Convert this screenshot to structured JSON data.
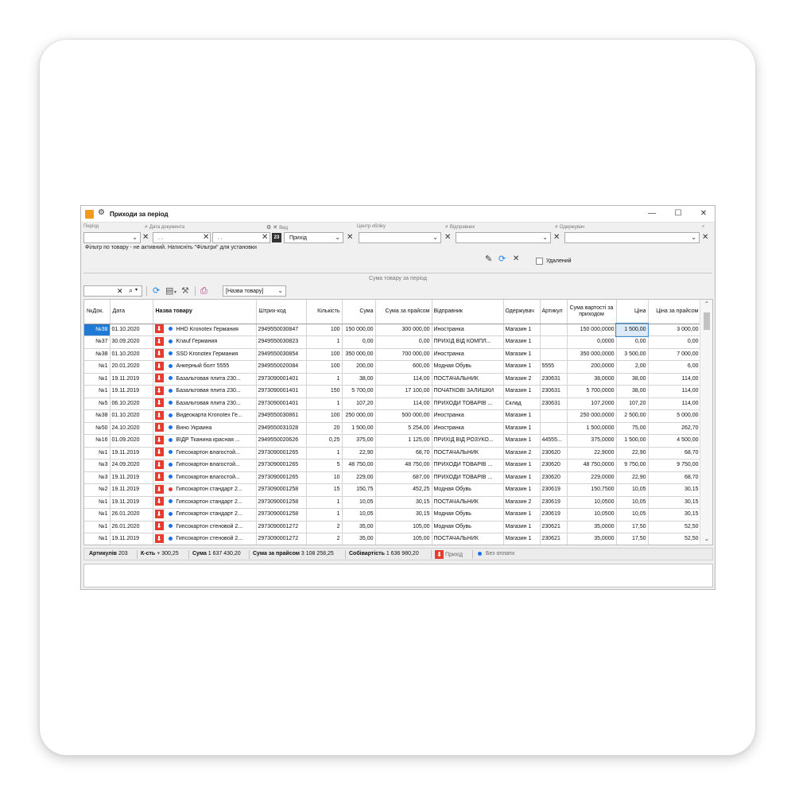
{
  "window": {
    "title": "Приходи за період",
    "controls": {
      "minimize": "—",
      "maximize": "☐",
      "close": "✕"
    }
  },
  "filters": {
    "labels": {
      "period": "Період",
      "doc_date": "Дата документа",
      "kind": "Вид",
      "center": "Центр обліку",
      "sender": "Відправник",
      "receiver": "Одержувач"
    },
    "date_from": ". .",
    "date_to": ". .",
    "calendar_day": "23",
    "kind_value": "Прихід",
    "hint": "Фільтр по товару - не активний. Натисніть \"Фільтри\" для установки",
    "deleted_label": "Удалений"
  },
  "sum_caption": "Сума товару за період",
  "toolbar": {
    "column_select": "[Назва товару]"
  },
  "columns": {
    "doc": "№Док.",
    "date": "Дата",
    "name": "Назва товару",
    "barcode": "Штрих-код",
    "qty": "Кількість",
    "sum": "Сума",
    "sum_price": "Сума за прайсом",
    "sender": "Відправник",
    "receiver": "Одержувач",
    "article": "Артикул",
    "cost": "Сума вартості за приходом",
    "price": "Ціна",
    "price_list": "Ціна за прайсом"
  },
  "rows": [
    {
      "doc": "№38",
      "date": "01.10.2020",
      "dot": "#1a73e8",
      "name": "HHD Kronotex Германия",
      "barcode": "2949550030847",
      "qty": "100",
      "sum": "150 000,00",
      "sum_price": "300 000,00",
      "sender": "Иностранка",
      "receiver": "Магазин 1",
      "article": "",
      "cost": "150 000,0000",
      "price": "1 500,00",
      "price_list": "3 000,00"
    },
    {
      "doc": "№37",
      "date": "30.09.2020",
      "dot": "#1a73e8",
      "name": "Knauf Германия",
      "barcode": "2949550030823",
      "qty": "1",
      "sum": "0,00",
      "sum_price": "0,00",
      "sender": "ПРИХІД ВІД КОМПЛ...",
      "receiver": "Магазин 1",
      "article": "",
      "cost": "0,0000",
      "price": "0,00",
      "price_list": "0,00"
    },
    {
      "doc": "№38",
      "date": "01.10.2020",
      "dot": "#1a73e8",
      "name": "SSD Kronotex Германия",
      "barcode": "2949550030854",
      "qty": "100",
      "sum": "350 000,00",
      "sum_price": "700 000,00",
      "sender": "Иностранка",
      "receiver": "Магазин 1",
      "article": "",
      "cost": "350 000,0000",
      "price": "3 500,00",
      "price_list": "7 000,00"
    },
    {
      "doc": "№1",
      "date": "20.01.2020",
      "dot": "#1a73e8",
      "name": "Анкерный болт 5555",
      "barcode": "2949550020084",
      "qty": "100",
      "sum": "200,00",
      "sum_price": "600,00",
      "sender": "Модная Обувь",
      "receiver": "Магазин 1",
      "article": "5555",
      "cost": "200,0000",
      "price": "2,00",
      "price_list": "6,00"
    },
    {
      "doc": "№1",
      "date": "19.11.2019",
      "dot": "#1a73e8",
      "name": "Базальтовая плита 230...",
      "barcode": "2973090001401",
      "qty": "1",
      "sum": "38,00",
      "sum_price": "114,00",
      "sender": "ПОСТАЧАЛЬНИК",
      "receiver": "Магазин 2",
      "article": "230631",
      "cost": "38,0000",
      "price": "38,00",
      "price_list": "114,00"
    },
    {
      "doc": "№1",
      "date": "19.11.2019",
      "dot": "#1a73e8",
      "name": "Базальтовая плита 230...",
      "barcode": "2973090001401",
      "qty": "150",
      "sum": "5 700,00",
      "sum_price": "17 100,00",
      "sender": "ПОЧАТКОВІ ЗАЛИШКИ",
      "receiver": "Магазин 1",
      "article": "230631",
      "cost": "5 700,0000",
      "price": "38,00",
      "price_list": "114,00"
    },
    {
      "doc": "№5",
      "date": "06.10.2020",
      "dot": "#1a73e8",
      "name": "Базальтовая плита 230...",
      "barcode": "2973090001401",
      "qty": "1",
      "sum": "107,20",
      "sum_price": "114,00",
      "sender": "ПРИХОДИ ТОВАРІВ ...",
      "receiver": "Склад",
      "article": "230631",
      "cost": "107,2000",
      "price": "107,20",
      "price_list": "114,00"
    },
    {
      "doc": "№38",
      "date": "01.10.2020",
      "dot": "#1a73e8",
      "name": "Видеокарта Kronotex Ге...",
      "barcode": "2949550030861",
      "qty": "100",
      "sum": "250 000,00",
      "sum_price": "500 000,00",
      "sender": "Иностранка",
      "receiver": "Магазин 1",
      "article": "",
      "cost": "250 000,0000",
      "price": "2 500,00",
      "price_list": "5 000,00"
    },
    {
      "doc": "№50",
      "date": "24.10.2020",
      "dot": "#1a73e8",
      "name": "Вино Украина",
      "barcode": "2949550031028",
      "qty": "20",
      "sum": "1 500,00",
      "sum_price": "5 254,00",
      "sender": "Иностранка",
      "receiver": "Магазин 1",
      "article": "",
      "cost": "1 500,0000",
      "price": "75,00",
      "price_list": "262,70"
    },
    {
      "doc": "№16",
      "date": "01.09.2020",
      "dot": "#1a73e8",
      "name": "ВІДР Тканина красная ...",
      "barcode": "2949550020626",
      "qty": "0,25",
      "sum": "375,00",
      "sum_price": "1 125,00",
      "sender": "ПРИХІД ВІД РОЗУКО...",
      "receiver": "Магазин 1",
      "article": "44555...",
      "cost": "375,0000",
      "price": "1 500,00",
      "price_list": "4 500,00"
    },
    {
      "doc": "№1",
      "date": "19.11.2019",
      "dot": "#1a73e8",
      "name": "Гипсокартон влагостой...",
      "barcode": "2973090001265",
      "qty": "1",
      "sum": "22,90",
      "sum_price": "68,70",
      "sender": "ПОСТАЧАЛЬНИК",
      "receiver": "Магазин 2",
      "article": "230620",
      "cost": "22,9000",
      "price": "22,90",
      "price_list": "68,70"
    },
    {
      "doc": "№3",
      "date": "24.09.2020",
      "dot": "#1a73e8",
      "name": "Гипсокартон влагостой...",
      "barcode": "2973090001265",
      "qty": "5",
      "sum": "48 750,00",
      "sum_price": "48 750,00",
      "sender": "ПРИХОДИ ТОВАРІВ ...",
      "receiver": "Магазин 1",
      "article": "230620",
      "cost": "48 750,0000",
      "price": "9 750,00",
      "price_list": "9 750,00"
    },
    {
      "doc": "№3",
      "date": "19.11.2019",
      "dot": "#1a73e8",
      "name": "Гипсокартон влагостой...",
      "barcode": "2973090001265",
      "qty": "10",
      "sum": "229,00",
      "sum_price": "687,00",
      "sender": "ПРИХОДИ ТОВАРІВ ...",
      "receiver": "Магазин 1",
      "article": "230620",
      "cost": "229,0000",
      "price": "22,90",
      "price_list": "68,70"
    },
    {
      "doc": "№2",
      "date": "19.11.2019",
      "dot": "#e23b2e",
      "name": "Гипсокартон стандарт 2...",
      "barcode": "2973090001258",
      "qty": "15",
      "sum": "150,75",
      "sum_price": "452,25",
      "sender": "Модная Обувь",
      "receiver": "Магазин 1",
      "article": "230619",
      "cost": "150,7500",
      "price": "10,05",
      "price_list": "30,15"
    },
    {
      "doc": "№1",
      "date": "19.11.2019",
      "dot": "#1a73e8",
      "name": "Гипсокартон стандарт 2...",
      "barcode": "2973090001258",
      "qty": "1",
      "sum": "10,05",
      "sum_price": "30,15",
      "sender": "ПОСТАЧАЛЬНИК",
      "receiver": "Магазин 2",
      "article": "230619",
      "cost": "10,0500",
      "price": "10,05",
      "price_list": "30,15"
    },
    {
      "doc": "№1",
      "date": "26.01.2020",
      "dot": "#1a73e8",
      "name": "Гипсокартон стандарт 2...",
      "barcode": "2973090001258",
      "qty": "1",
      "sum": "10,05",
      "sum_price": "30,15",
      "sender": "Модная Обувь",
      "receiver": "Магазин 1",
      "article": "230619",
      "cost": "10,0500",
      "price": "10,05",
      "price_list": "30,15"
    },
    {
      "doc": "№1",
      "date": "26.01.2020",
      "dot": "#1a73e8",
      "name": "Гипсокартон стеновой 2...",
      "barcode": "2973090001272",
      "qty": "2",
      "sum": "35,00",
      "sum_price": "105,00",
      "sender": "Модная Обувь",
      "receiver": "Магазин 1",
      "article": "230621",
      "cost": "35,0000",
      "price": "17,50",
      "price_list": "52,50"
    },
    {
      "doc": "№1",
      "date": "19.11.2019",
      "dot": "#1a73e8",
      "name": "Гипсокартон стеновой 2...",
      "barcode": "2973090001272",
      "qty": "2",
      "sum": "35,00",
      "sum_price": "105,00",
      "sender": "ПОСТАЧАЛЬНИК",
      "receiver": "Магазин 1",
      "article": "230621",
      "cost": "35,0000",
      "price": "17,50",
      "price_list": "52,50"
    }
  ],
  "status": {
    "articles_label": "Артикулів",
    "articles_value": "203",
    "qty_label": "К-сть",
    "qty_value": "+ 300,25",
    "sum_label": "Сума",
    "sum_value": "1 637 430,20",
    "sum_price_label": "Сума за прайсом",
    "sum_price_value": "3 108 258,25",
    "cost_label": "Собівартість",
    "cost_value": "1 636 980,20",
    "legend_income": "Прихід",
    "legend_unpaid": "Без оплати"
  },
  "colors": {
    "accent": "#1e7ad4",
    "income": "#e63c30",
    "unpaid": "#1a73e8",
    "paid_dot": "#e23b2e"
  },
  "icons": [
    "gear-icon",
    "search-icon",
    "calendar-icon",
    "edit-icon",
    "refresh-icon",
    "printer-icon",
    "clipboard-icon",
    "wrench-icon"
  ]
}
